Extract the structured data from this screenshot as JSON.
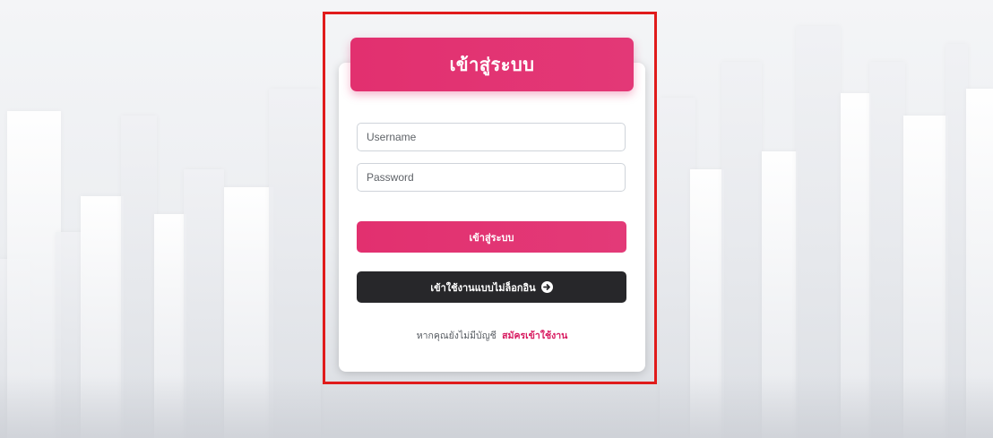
{
  "login_card": {
    "title": "เข้าสู่ระบบ",
    "username_placeholder": "Username",
    "password_placeholder": "Password",
    "login_button_label": "เข้าสู่ระบบ",
    "guest_button_label": "เข้าใช้งานแบบไม่ล็อกอิน",
    "guest_button_icon": "arrow-right-circle-icon",
    "register_prompt": "หากคุณยังไม่มีบัญชี",
    "register_link_label": "สมัครเข้าใช้งาน"
  },
  "colors": {
    "accent": "#e2306f",
    "dark_button": "#27272a",
    "link": "#d81b60",
    "highlight_frame": "#e01b1b"
  }
}
